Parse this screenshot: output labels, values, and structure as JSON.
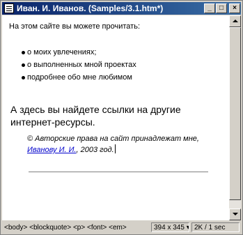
{
  "window": {
    "title": "Иван. И. Иванов. (Samples/3.1.htm*)",
    "minimize_glyph": "_",
    "maximize_glyph": "□",
    "close_glyph": "×"
  },
  "content": {
    "intro": "На этом сайте вы можете прочитать:",
    "list_items": [
      "о моих увлечениях;",
      "о выполненных мной проектах",
      "подробнее обо мне любимом"
    ],
    "links_text": "А здесь вы найдете ссылки на другие интернет-ресурсы.",
    "copyright_prefix": "© Авторские права на сайт принадлежат мне, ",
    "copyright_link": "Иванову И. И.",
    "copyright_suffix": ", 2003 год."
  },
  "statusbar": {
    "tags": "<body> <blockquote> <p> <font> <em>",
    "size": "394 x 345 ▾",
    "stats": "2K / 1 sec"
  },
  "colors": {
    "titlebar_start": "#0a246a",
    "titlebar_end": "#3a6ea5",
    "link": "#0000cc",
    "chrome": "#d4d0c8"
  }
}
